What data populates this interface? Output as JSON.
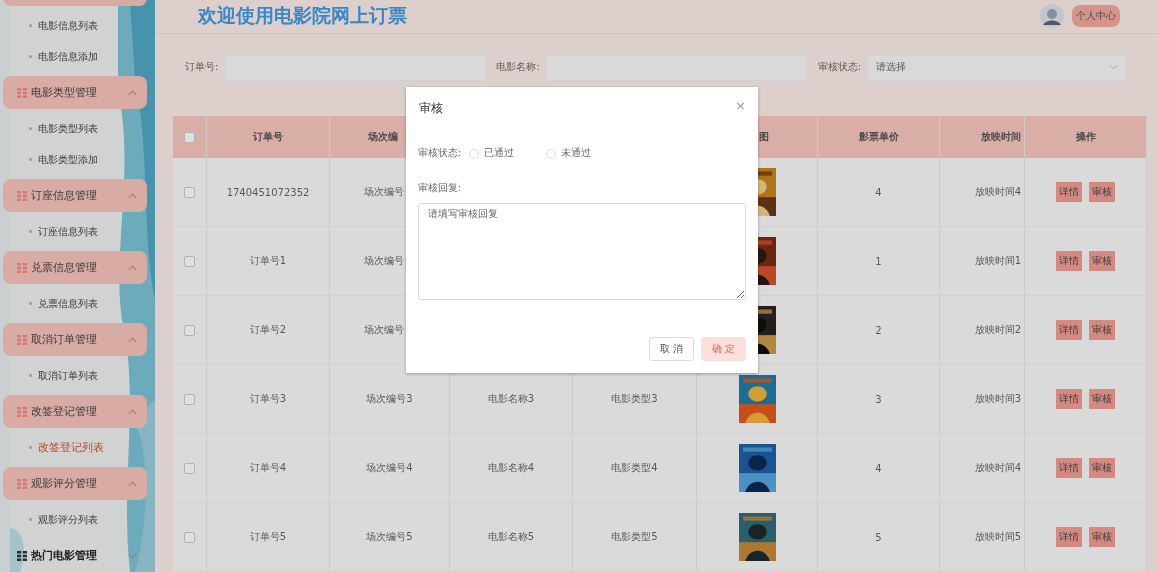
{
  "sidebar": {
    "groups": [
      {
        "expanded": true,
        "items": [
          {
            "label": "电影信息列表",
            "selected": false
          },
          {
            "label": "电影信息添加",
            "selected": false
          }
        ]
      },
      {
        "label": "电影类型管理",
        "expanded": true,
        "items": [
          {
            "label": "电影类型列表",
            "selected": false
          },
          {
            "label": "电影类型添加",
            "selected": false
          }
        ]
      },
      {
        "label": "订座信息管理",
        "expanded": true,
        "items": [
          {
            "label": "订座信息列表",
            "selected": false
          }
        ]
      },
      {
        "label": "兑票信息管理",
        "expanded": true,
        "items": [
          {
            "label": "兑票信息列表",
            "selected": false
          }
        ]
      },
      {
        "label": "取消订单管理",
        "expanded": true,
        "items": [
          {
            "label": "取消订单列表",
            "selected": false
          }
        ]
      },
      {
        "label": "改签登记管理",
        "expanded": true,
        "items": [
          {
            "label": "改签登记列表",
            "selected": true
          }
        ]
      },
      {
        "label": "观影评分管理",
        "expanded": true,
        "items": [
          {
            "label": "观影评分列表",
            "selected": false
          }
        ]
      },
      {
        "label": "热门电影管理",
        "expanded": false
      }
    ]
  },
  "header": {
    "title": "欢迎使用电影院网上订票",
    "user_button": "个人中心"
  },
  "filters": [
    {
      "kind": "input",
      "label": "订单号:"
    },
    {
      "kind": "input",
      "label": "电影名称:"
    },
    {
      "kind": "select",
      "label": "审核状态:",
      "placeholder": "请选择"
    }
  ],
  "table": {
    "select_all": {
      "checked": false
    },
    "header": {
      "order_no": "订单号",
      "session_no": "场次编",
      "cover": "图",
      "price": "影票单价",
      "show_time": "放映时间",
      "actions": "操作"
    },
    "rows": [
      {
        "checked": false,
        "order_no": "1740451072352",
        "session_no": "场次编号",
        "cover": {
          "kind": "picture"
        },
        "price": "4",
        "show_time": "放映时间4",
        "actions": [
          "详情",
          "审核"
        ]
      },
      {
        "checked": false,
        "order_no": "订单号1",
        "session_no": "场次编号",
        "cover": {
          "kind": "picture"
        },
        "price": "1",
        "show_time": "放映时间1",
        "actions": [
          "详情",
          "审核"
        ]
      },
      {
        "checked": false,
        "order_no": "订单号2",
        "session_no": "场次编号",
        "cover": {
          "kind": "picture"
        },
        "price": "2",
        "show_time": "放映时间2",
        "actions": [
          "详情",
          "审核"
        ]
      },
      {
        "checked": false,
        "order_no": "订单号3",
        "session_no": "场次编号3",
        "movie_name": "电影名称3",
        "movie_type": "电影类型3",
        "cover": {
          "kind": "picture"
        },
        "price": "3",
        "show_time": "放映时间3",
        "actions": [
          "详情",
          "审核"
        ]
      },
      {
        "checked": false,
        "order_no": "订单号4",
        "session_no": "场次编号4",
        "movie_name": "电影名称4",
        "movie_type": "电影类型4",
        "cover": {
          "kind": "picture"
        },
        "price": "4",
        "show_time": "放映时间4",
        "actions": [
          "详情",
          "审核"
        ]
      },
      {
        "checked": false,
        "order_no": "订单号5",
        "session_no": "场次编号5",
        "movie_name": "电影名称5",
        "movie_type": "电影类型5",
        "cover": {
          "kind": "picture"
        },
        "price": "5",
        "show_time": "放映时间5",
        "actions": [
          "详情",
          "审核"
        ]
      }
    ]
  },
  "dialog": {
    "title": "审核",
    "close": "×",
    "fields": [
      {
        "kind": "radio",
        "label": "审核状态:",
        "options": [
          {
            "label": "已通过",
            "selected": false
          },
          {
            "label": "未通过",
            "selected": false
          }
        ]
      },
      {
        "kind": "textarea",
        "label": "审核回复:",
        "placeholder": "请填写审核回复"
      }
    ],
    "buttons": [
      {
        "kind": "default",
        "label": "取 消",
        "disabled": false
      },
      {
        "kind": "primary",
        "label": "确 定",
        "disabled": true
      }
    ]
  }
}
